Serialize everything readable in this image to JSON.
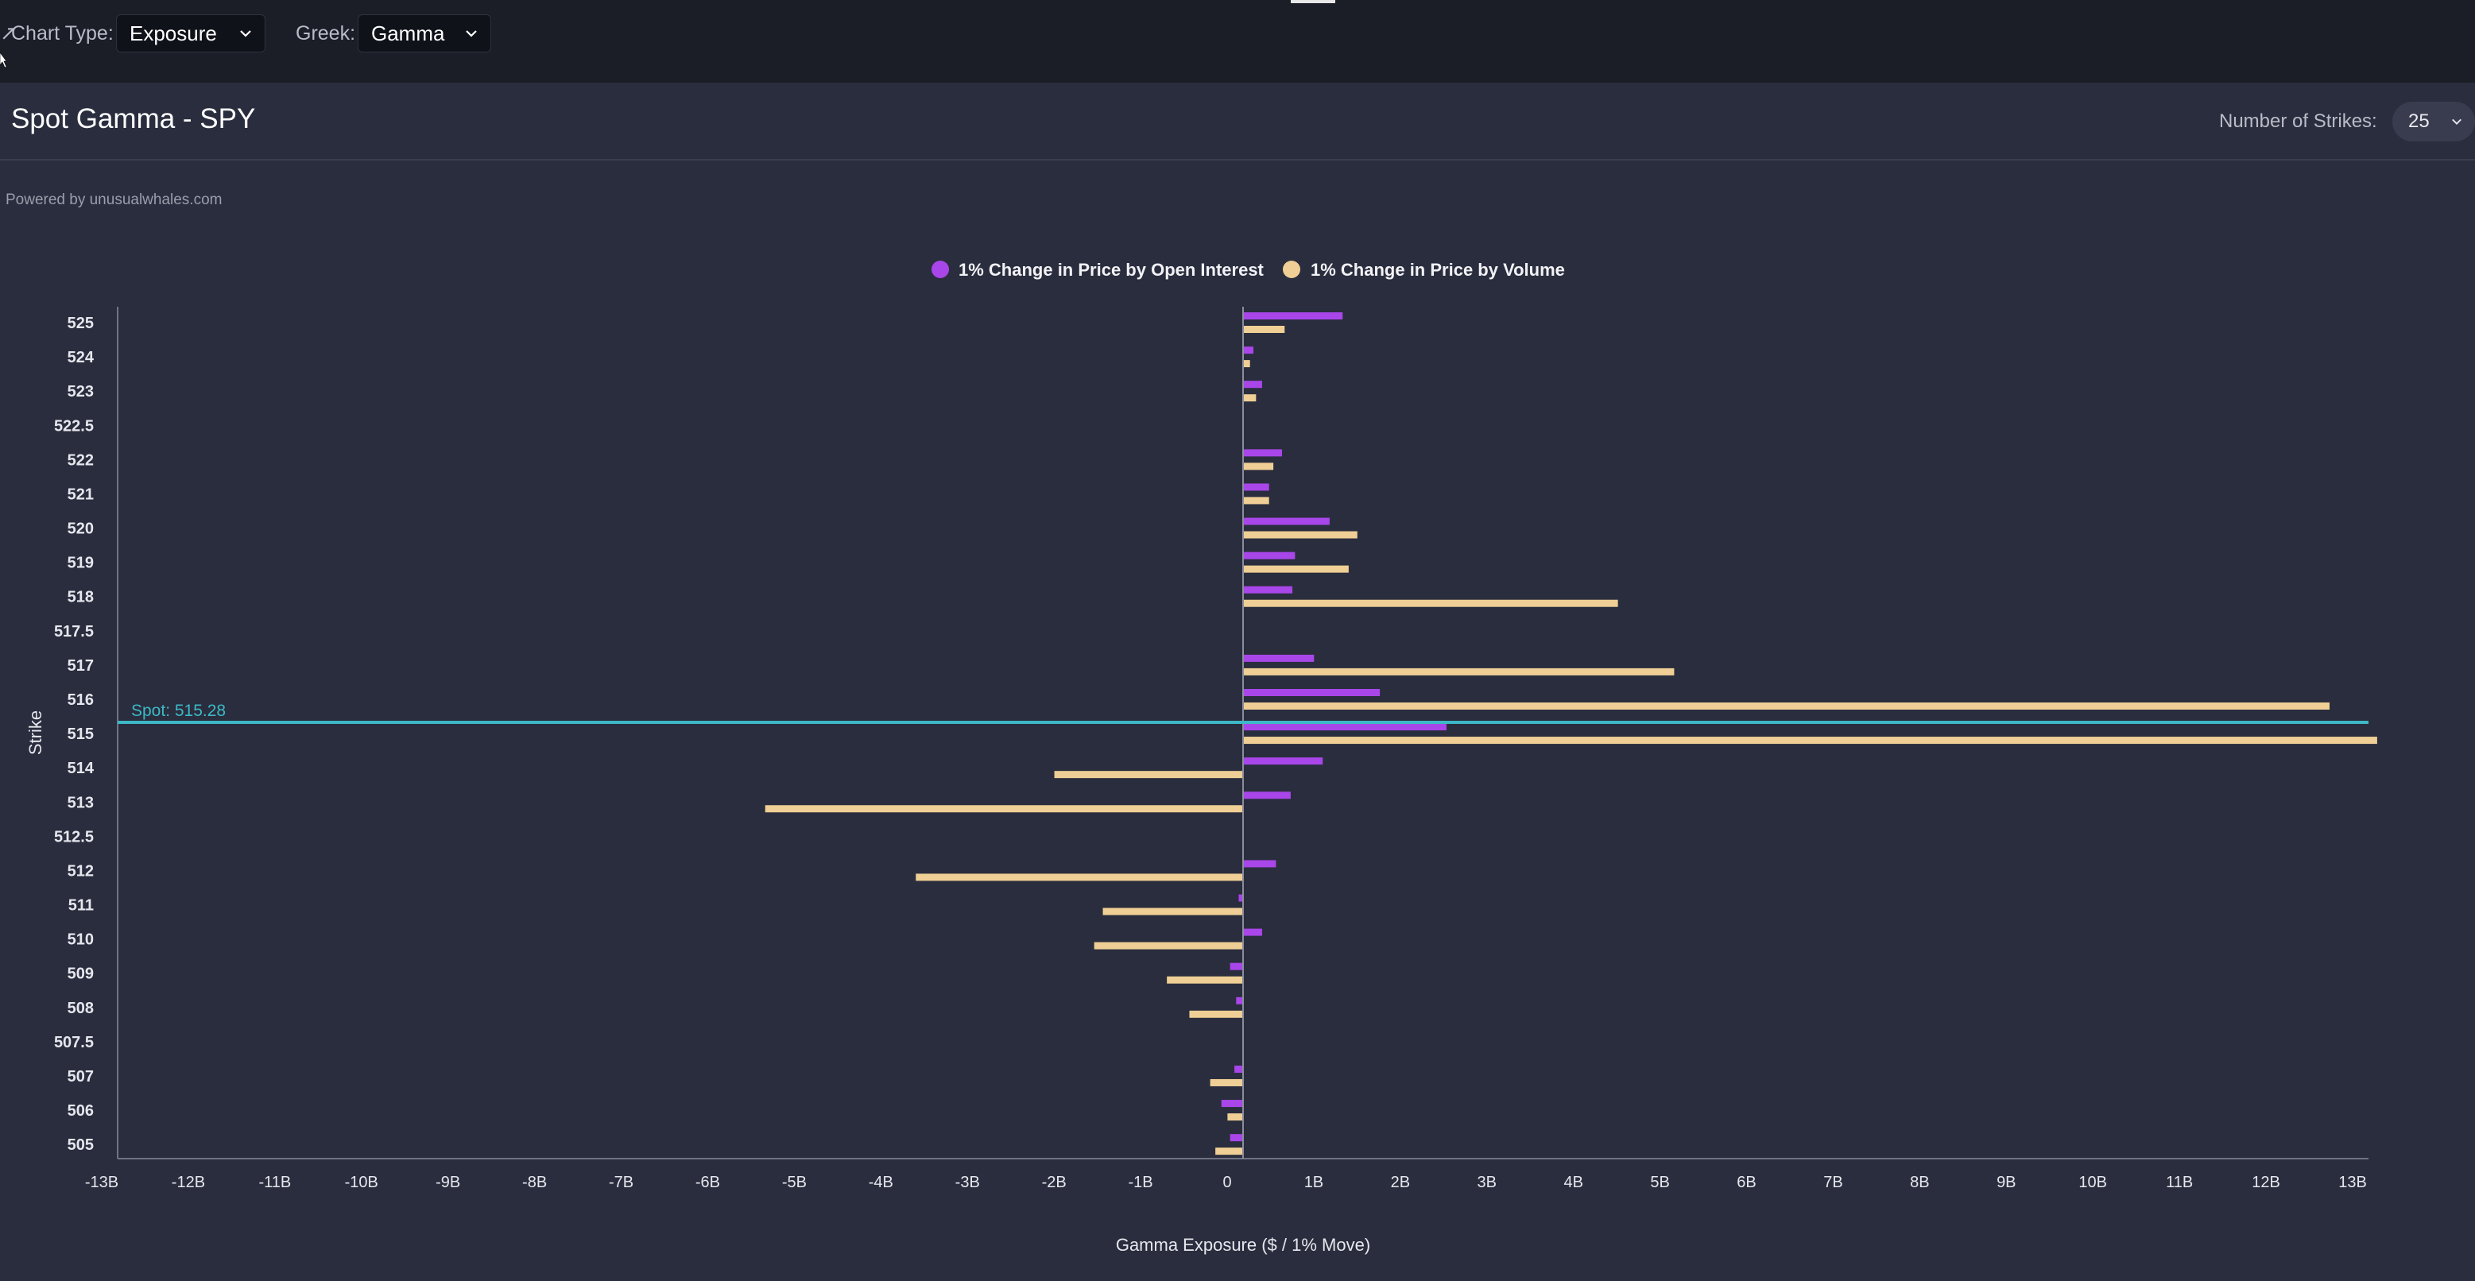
{
  "toolbar": {
    "chart_type_label": "Chart Type:",
    "chart_type_value": "Exposure",
    "greek_label": "Greek:",
    "greek_value": "Gamma"
  },
  "header": {
    "title": "Spot Gamma - SPY",
    "strikes_label": "Number of Strikes:",
    "strikes_value": "25"
  },
  "powered_by": "Powered by unusualwhales.com",
  "colors": {
    "open_interest": "#a946ea",
    "volume": "#efcf95",
    "spot_line": "#3db8c6",
    "axis": "#6f7384"
  },
  "chart_data": {
    "type": "bar",
    "orientation": "horizontal",
    "xlabel": "Gamma Exposure ($ / 1% Move)",
    "ylabel": "Strike",
    "xlim": [
      -13,
      13
    ],
    "x_unit": "B",
    "x_ticks": [
      "-13B",
      "-12B",
      "-11B",
      "-10B",
      "-9B",
      "-8B",
      "-7B",
      "-6B",
      "-5B",
      "-4B",
      "-3B",
      "-2B",
      "-1B",
      "0",
      "1B",
      "2B",
      "3B",
      "4B",
      "5B",
      "6B",
      "7B",
      "8B",
      "9B",
      "10B",
      "11B",
      "12B",
      "13B"
    ],
    "categories": [
      "525",
      "524",
      "523",
      "522.5",
      "522",
      "521",
      "520",
      "519",
      "518",
      "517.5",
      "517",
      "516",
      "515",
      "514",
      "513",
      "512.5",
      "512",
      "511",
      "510",
      "509",
      "508",
      "507.5",
      "507",
      "506",
      "505"
    ],
    "series": [
      {
        "name": "1% Change in Price by Open Interest",
        "values": [
          1.15,
          0.12,
          0.22,
          0,
          0.45,
          0.3,
          1.0,
          0.6,
          0.57,
          0,
          0.82,
          1.58,
          2.35,
          0.92,
          0.55,
          0,
          0.38,
          -0.05,
          0.22,
          -0.15,
          -0.08,
          0,
          -0.1,
          -0.25,
          -0.15
        ]
      },
      {
        "name": "1% Change in Price by Volume",
        "values": [
          0.48,
          0.08,
          0.15,
          0,
          0.35,
          0.3,
          1.32,
          1.22,
          4.33,
          0,
          4.98,
          12.55,
          13.1,
          -2.18,
          -5.52,
          0,
          -3.78,
          -1.62,
          -1.72,
          -0.88,
          -0.62,
          0,
          -0.38,
          -0.18,
          -0.32
        ]
      }
    ],
    "spot": {
      "label": "Spot: 515.28",
      "value": 515.28
    },
    "legend_position": "top-center",
    "grid": false
  }
}
